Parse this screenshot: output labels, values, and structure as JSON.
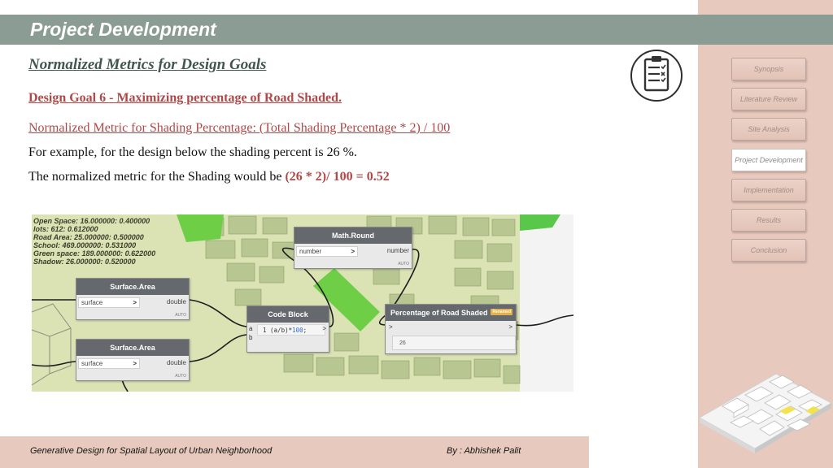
{
  "header": {
    "title": "Project Development"
  },
  "content": {
    "section_heading": "Normalized Metrics for Design Goals",
    "goal_heading": "Design Goal 6 - Maximizing percentage of Road Shaded.",
    "metric_line": "Normalized Metric for Shading Percentage: (Total Shading Percentage * 2) / 100",
    "example_line": "For example, for the design below the shading percent is 26 %.",
    "result_prefix": "The normalized metric for the Shading would be ",
    "result_formula": "(26 * 2)/ 100 = 0.52"
  },
  "sidebar": {
    "items": [
      {
        "label": "Synopsis",
        "active": false
      },
      {
        "label": "Literature Review",
        "active": false
      },
      {
        "label": "Site Analysis",
        "active": false
      },
      {
        "label": "Project Development",
        "active": true
      },
      {
        "label": "Implementation",
        "active": false
      },
      {
        "label": "Results",
        "active": false
      },
      {
        "label": "Conclusion",
        "active": false
      }
    ]
  },
  "icons": {
    "clipboard": "clipboard-checklist-icon"
  },
  "canvas": {
    "metrics_text": "Open Space: 16.000000: 0.400000\nlots: 612: 0.612000\nRoad Area: 25.000000: 0.500000\nSchool: 469.000000: 0.531000\nGreen space: 189.000000: 0.622000\nShadow: 26.000000: 0.520000",
    "nodes": {
      "surface_area_1": {
        "title": "Surface.Area",
        "input": "surface",
        "output": "double",
        "auto": "AUTO"
      },
      "surface_area_2": {
        "title": "Surface.Area",
        "input": "surface",
        "output": "double",
        "auto": "AUTO"
      },
      "math_round": {
        "title": "Math.Round",
        "input": "number",
        "output": "number",
        "auto": "AUTO"
      },
      "code_block": {
        "title": "Code Block",
        "port_a": "a",
        "port_b": "b",
        "line_no": "1",
        "code_pre": "(a/b)*",
        "code_num": "100",
        "code_post": ";",
        "out_arrow": ">"
      },
      "watch": {
        "title": "Percentage of Road Shaded",
        "badge": "Renamed",
        "in_arrow": ">",
        "out_arrow": ">",
        "value": "26"
      }
    },
    "arrow_glyph": ">"
  },
  "footer": {
    "left": "Generative Design for Spatial Layout of Urban Neighborhood",
    "right": "By : Abhishek Palit"
  },
  "colors": {
    "header_bar": "#8b9c94",
    "sidebar": "#e8c9bd",
    "accent_red": "#b04848",
    "heading_green": "#42564d",
    "node_title": "#65696e"
  }
}
